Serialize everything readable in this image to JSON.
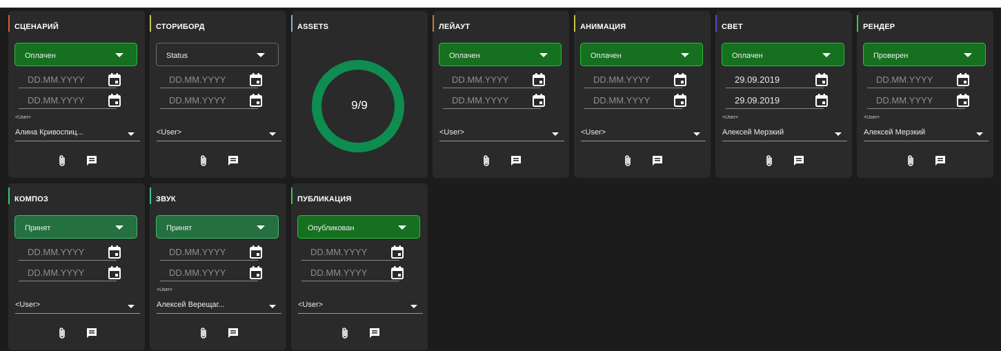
{
  "cards": [
    {
      "title": "СЦЕНАРИЙ",
      "accent": "#d85a3a",
      "status": "Оплачен",
      "status_style": "green",
      "dates": [
        "DD.MM.YYYY",
        "DD.MM.YYYY"
      ],
      "dates_filled": false,
      "user_label": "<User>",
      "user": "Алина Кривоспиц..."
    },
    {
      "title": "СТОРИБОРД",
      "accent": "#c2c94a",
      "status": "Status",
      "status_style": "empty",
      "dates": [
        "DD.MM.YYYY",
        "DD.MM.YYYY"
      ],
      "dates_filled": false,
      "user_label": "",
      "user": "<User>"
    },
    {
      "title": "ASSETS",
      "accent": "#8fb0d6",
      "ring": true,
      "progress_text": "9/9",
      "progress_fraction": 1.0,
      "ring_color": "#0f8c4f"
    },
    {
      "title": "ЛЕЙАУТ",
      "accent": "#c87a3a",
      "status": "Оплачен",
      "status_style": "green",
      "dates": [
        "DD.MM.YYYY",
        "DD.MM.YYYY"
      ],
      "dates_filled": false,
      "user_label": "",
      "user": "<User>"
    },
    {
      "title": "АНИМАЦИЯ",
      "accent": "#c9c44a",
      "status": "Оплачен",
      "status_style": "green",
      "dates": [
        "DD.MM.YYYY",
        "DD.MM.YYYY"
      ],
      "dates_filled": false,
      "user_label": "",
      "user": "<User>"
    },
    {
      "title": "СВЕТ",
      "accent": "#5a4ac9",
      "status": "Оплачен",
      "status_style": "green",
      "dates": [
        "29.09.2019",
        "29.09.2019"
      ],
      "dates_filled": true,
      "user_label": "<User>",
      "user": "Алексей Мерзкий"
    },
    {
      "title": "РЕНДЕР",
      "accent": "#3ac94a",
      "status": "Проверен",
      "status_style": "green",
      "dates": [
        "DD.MM.YYYY",
        "DD.MM.YYYY"
      ],
      "dates_filled": false,
      "user_label": "<User>",
      "user": "Алексей Мерзкий"
    },
    {
      "title": "КОМПОЗ",
      "accent": "#3ac96a",
      "status": "Принят",
      "status_style": "teal",
      "dates": [
        "DD.MM.YYYY",
        "DD.MM.YYYY"
      ],
      "dates_filled": false,
      "user_label": "",
      "user": "<User>"
    },
    {
      "title": "ЗВУК",
      "accent": "#3ac99a",
      "status": "Принят",
      "status_style": "teal",
      "dates": [
        "DD.MM.YYYY",
        "DD.MM.YYYY"
      ],
      "dates_filled": false,
      "user_label": "<User>",
      "user": "Алексей Верещаг..."
    },
    {
      "title": "ПУБЛИКАЦИЯ",
      "accent": "#3ac94a",
      "status": "Опубликован",
      "status_style": "green",
      "dates": [
        "DD.MM.YYYY",
        "DD.MM.YYYY"
      ],
      "dates_filled": false,
      "user_label": "",
      "user": "<User>"
    }
  ],
  "icons": {
    "attach": "paperclip-icon",
    "comment": "comment-icon",
    "calendar": "calendar-icon",
    "dropdown": "chevron-down-icon"
  },
  "colors": {
    "background": "#1c1c1c",
    "card": "#2a2a2a",
    "status_green": "#15701f",
    "status_teal": "#24703f",
    "ring": "#0f8c4f"
  }
}
